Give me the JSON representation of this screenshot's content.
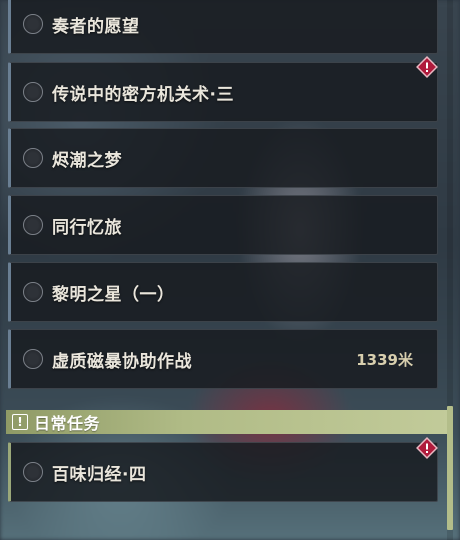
{
  "quests": [
    {
      "title": "奏者的愿望",
      "alert": false,
      "distance": ""
    },
    {
      "title": "传说中的密方机关术·三",
      "alert": true,
      "distance": ""
    },
    {
      "title": "烬潮之梦",
      "alert": false,
      "distance": ""
    },
    {
      "title": "同行忆旅",
      "alert": false,
      "distance": ""
    },
    {
      "title": "黎明之星（一）",
      "alert": false,
      "distance": ""
    },
    {
      "title": "虚质磁暴协助作战",
      "alert": false,
      "distance": "1339米"
    }
  ],
  "daily_section": {
    "label": "日常任务",
    "icon": "exclamation-icon",
    "quests": [
      {
        "title": "百味归经·四",
        "alert": true,
        "distance": ""
      }
    ]
  },
  "colors": {
    "accent_daily": "#b0bb86",
    "alert_red": "#b01b3c",
    "distance_text": "#d8cfae"
  }
}
